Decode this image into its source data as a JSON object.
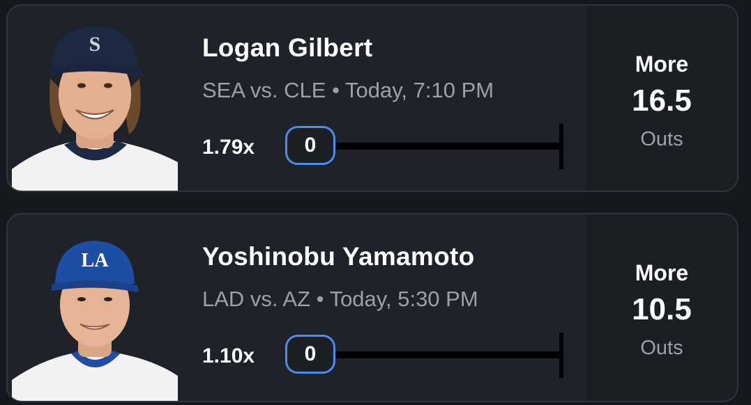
{
  "picks": [
    {
      "player_name": "Logan Gilbert",
      "matchup": "SEA vs. CLE • Today, 7:10 PM",
      "multiplier": "1.79x",
      "progress_value": "0",
      "pick_direction": "More",
      "line": "16.5",
      "stat": "Outs",
      "cap_logo": "S",
      "cap_color": "#1d2a44",
      "accent_color": "#4b8fe8"
    },
    {
      "player_name": "Yoshinobu Yamamoto",
      "matchup": "LAD vs. AZ • Today, 5:30 PM",
      "multiplier": "1.10x",
      "progress_value": "0",
      "pick_direction": "More",
      "line": "10.5",
      "stat": "Outs",
      "cap_logo": "LA",
      "cap_color": "#1e4ea3",
      "accent_color": "#4b8fe8"
    }
  ]
}
